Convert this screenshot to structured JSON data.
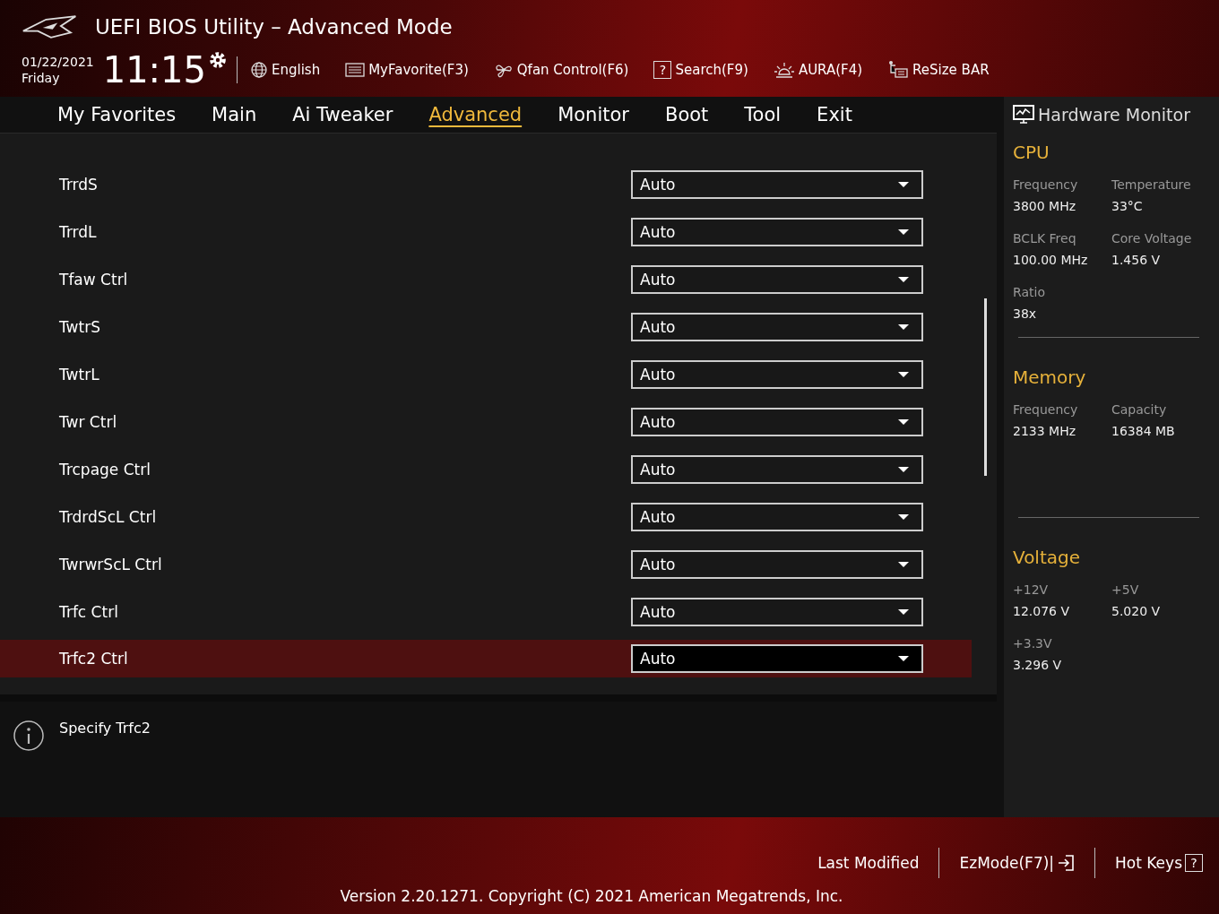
{
  "window": {
    "title": "UEFI BIOS Utility – Advanced Mode"
  },
  "header": {
    "date": "01/22/2021",
    "day": "Friday",
    "time": "11:15",
    "tools": [
      {
        "kind": "globe",
        "label": "English"
      },
      {
        "kind": "favorite",
        "label": "MyFavorite(F3)"
      },
      {
        "kind": "fan",
        "label": "Qfan Control(F6)"
      },
      {
        "kind": "search",
        "glyph": "?",
        "label": "Search(F9)"
      },
      {
        "kind": "aura",
        "label": "AURA(F4)"
      },
      {
        "kind": "resize",
        "label": "ReSize BAR"
      }
    ]
  },
  "tabs": [
    {
      "label": "My Favorites",
      "selected": false
    },
    {
      "label": "Main",
      "selected": false
    },
    {
      "label": "Ai Tweaker",
      "selected": false
    },
    {
      "label": "Advanced",
      "selected": true
    },
    {
      "label": "Monitor",
      "selected": false
    },
    {
      "label": "Boot",
      "selected": false
    },
    {
      "label": "Tool",
      "selected": false
    },
    {
      "label": "Exit",
      "selected": false
    }
  ],
  "settings": [
    {
      "label": "TrrdS",
      "value": "Auto",
      "selected": false
    },
    {
      "label": "TrrdL",
      "value": "Auto",
      "selected": false
    },
    {
      "label": "Tfaw Ctrl",
      "value": "Auto",
      "selected": false
    },
    {
      "label": "TwtrS",
      "value": "Auto",
      "selected": false
    },
    {
      "label": "TwtrL",
      "value": "Auto",
      "selected": false
    },
    {
      "label": "Twr Ctrl",
      "value": "Auto",
      "selected": false
    },
    {
      "label": "Trcpage Ctrl",
      "value": "Auto",
      "selected": false
    },
    {
      "label": "TrdrdScL Ctrl",
      "value": "Auto",
      "selected": false
    },
    {
      "label": "TwrwrScL Ctrl",
      "value": "Auto",
      "selected": false
    },
    {
      "label": "Trfc Ctrl",
      "value": "Auto",
      "selected": false
    },
    {
      "label": "Trfc2 Ctrl",
      "value": "Auto",
      "selected": true
    }
  ],
  "description": "Specify Trfc2",
  "hardware_monitor": {
    "title": "Hardware Monitor",
    "sections": [
      {
        "title": "CPU",
        "items": [
          {
            "label": "Frequency",
            "value": "3800 MHz"
          },
          {
            "label": "Temperature",
            "value": "33°C"
          },
          {
            "label": "BCLK Freq",
            "value": "100.00 MHz"
          },
          {
            "label": "Core Voltage",
            "value": "1.456 V"
          },
          {
            "label": "Ratio",
            "value": "38x"
          }
        ]
      },
      {
        "title": "Memory",
        "items": [
          {
            "label": "Frequency",
            "value": "2133 MHz"
          },
          {
            "label": "Capacity",
            "value": "16384 MB"
          }
        ]
      },
      {
        "title": "Voltage",
        "items": [
          {
            "label": "+12V",
            "value": "12.076 V"
          },
          {
            "label": "+5V",
            "value": "5.020 V"
          },
          {
            "label": "+3.3V",
            "value": "3.296 V"
          }
        ]
      }
    ]
  },
  "footer": {
    "buttons": [
      {
        "kind": "plain",
        "label": "Last Modified"
      },
      {
        "kind": "exit",
        "label": "EzMode(F7)|"
      },
      {
        "kind": "help",
        "label": "Hot Keys",
        "glyph": "?"
      }
    ],
    "version": "Version 2.20.1271. Copyright (C) 2021 American Megatrends, Inc."
  }
}
